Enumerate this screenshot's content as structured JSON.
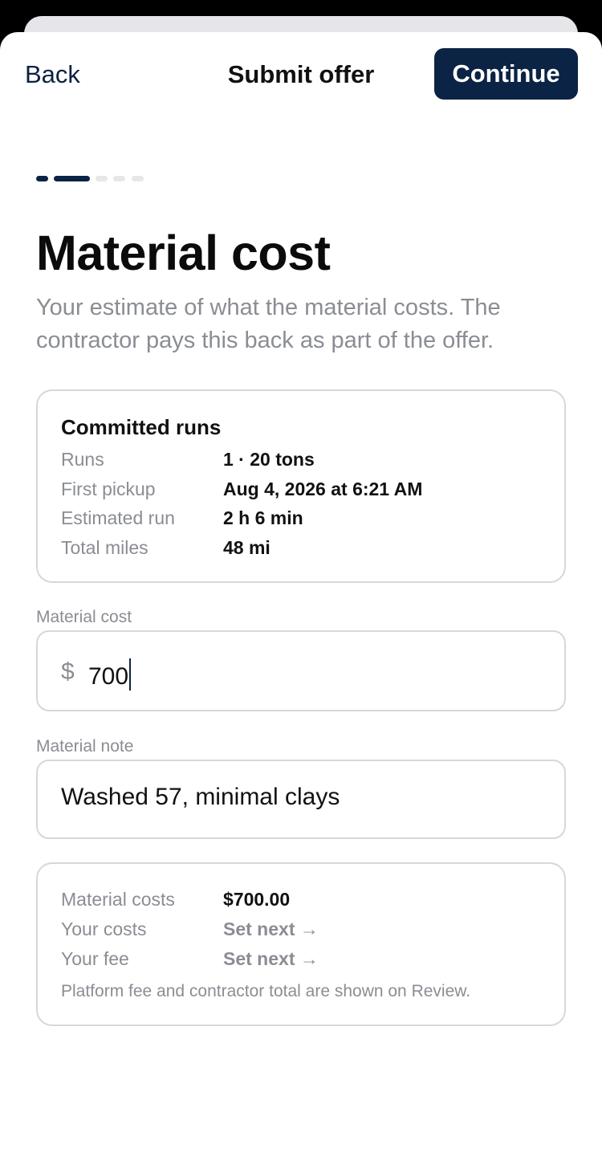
{
  "header": {
    "back_label": "Back",
    "title": "Submit offer",
    "continue_label": "Continue"
  },
  "progress": {
    "current_step": 2,
    "total_steps": 5
  },
  "page": {
    "title": "Material cost",
    "subtitle": "Your estimate of what the material costs. The contractor pays this back as part of the offer."
  },
  "runs_card": {
    "title": "Committed runs",
    "rows": [
      {
        "label": "Runs",
        "value": "1 · 20 tons"
      },
      {
        "label": "First pickup",
        "value": "Aug 4, 2026 at 6:21 AM"
      },
      {
        "label": "Estimated run",
        "value": "2 h 6 min"
      },
      {
        "label": "Total miles",
        "value": "48 mi"
      }
    ]
  },
  "material_cost": {
    "label": "Material cost",
    "currency": "$",
    "value": "700"
  },
  "material_note": {
    "label": "Material note",
    "value": "Washed 57, minimal clays"
  },
  "summary_card": {
    "rows": [
      {
        "label": "Material costs",
        "value": "$700.00"
      },
      {
        "label": "Your costs",
        "value": "Set next →"
      },
      {
        "label": "Your fee",
        "value": "Set next →"
      }
    ],
    "footnote": "Platform fee and contractor total are shown on Review."
  },
  "colors": {
    "primary": "#0b2344",
    "muted_text": "#8a8d93",
    "border": "#d5d7db"
  }
}
